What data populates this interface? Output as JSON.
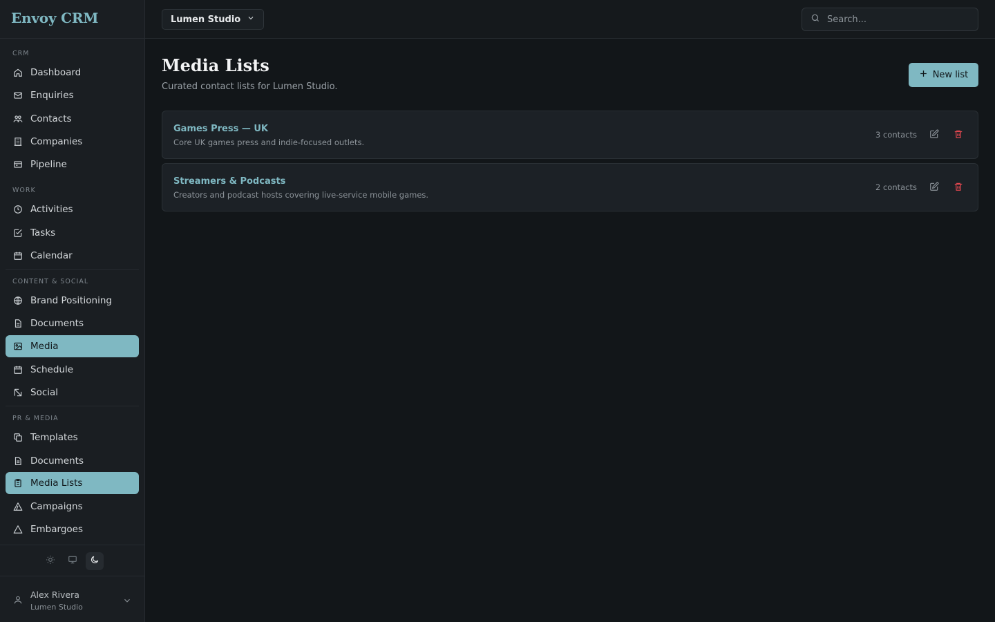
{
  "app": {
    "brand": "Envoy CRM"
  },
  "sidebar": {
    "sections": [
      {
        "label": "CRM",
        "items": [
          {
            "label": "Dashboard",
            "icon": "home-icon"
          },
          {
            "label": "Enquiries",
            "icon": "mail-icon"
          },
          {
            "label": "Contacts",
            "icon": "contacts-icon"
          },
          {
            "label": "Companies",
            "icon": "building-icon"
          },
          {
            "label": "Pipeline",
            "icon": "pipeline-icon"
          }
        ]
      },
      {
        "label": "WORK",
        "items": [
          {
            "label": "Activities",
            "icon": "clock-icon"
          },
          {
            "label": "Tasks",
            "icon": "checkbox-icon"
          },
          {
            "label": "Calendar",
            "icon": "calendar-icon"
          }
        ]
      },
      {
        "label": "CONTENT & SOCIAL",
        "items": [
          {
            "label": "Brand Positioning",
            "icon": "globe-icon"
          },
          {
            "label": "Documents",
            "icon": "document-icon"
          },
          {
            "label": "Media",
            "icon": "image-icon",
            "active": true
          },
          {
            "label": "Schedule",
            "icon": "calendar-icon"
          },
          {
            "label": "Social",
            "icon": "send-icon"
          }
        ]
      },
      {
        "label": "PR & MEDIA",
        "items": [
          {
            "label": "Templates",
            "icon": "copy-icon"
          },
          {
            "label": "Documents",
            "icon": "document-icon"
          },
          {
            "label": "Media Lists",
            "icon": "clipboard-icon",
            "active": true
          },
          {
            "label": "Campaigns",
            "icon": "triangle-icon"
          },
          {
            "label": "Embargoes",
            "icon": "warning-icon"
          }
        ]
      }
    ],
    "theme": {
      "options": [
        "sun-icon",
        "monitor-icon",
        "moon-icon"
      ],
      "active": "moon-icon"
    },
    "user": {
      "name": "Alex Rivera",
      "org": "Lumen Studio"
    }
  },
  "topbar": {
    "workspace": "Lumen Studio",
    "search_placeholder": "Search..."
  },
  "main": {
    "title": "Media Lists",
    "subtitle": "Curated contact lists for Lumen Studio.",
    "new_button": "New list",
    "lists": [
      {
        "title": "Games Press — UK",
        "description": "Core UK games press and indie-focused outlets.",
        "count": "3 contacts"
      },
      {
        "title": "Streamers & Podcasts",
        "description": "Creators and podcast hosts covering live-service mobile games.",
        "count": "2 contacts"
      }
    ]
  },
  "colors": {
    "accent": "#7fb8c2",
    "danger": "#e0474f",
    "background": "#121619",
    "sidebar": "#1a1e22"
  }
}
